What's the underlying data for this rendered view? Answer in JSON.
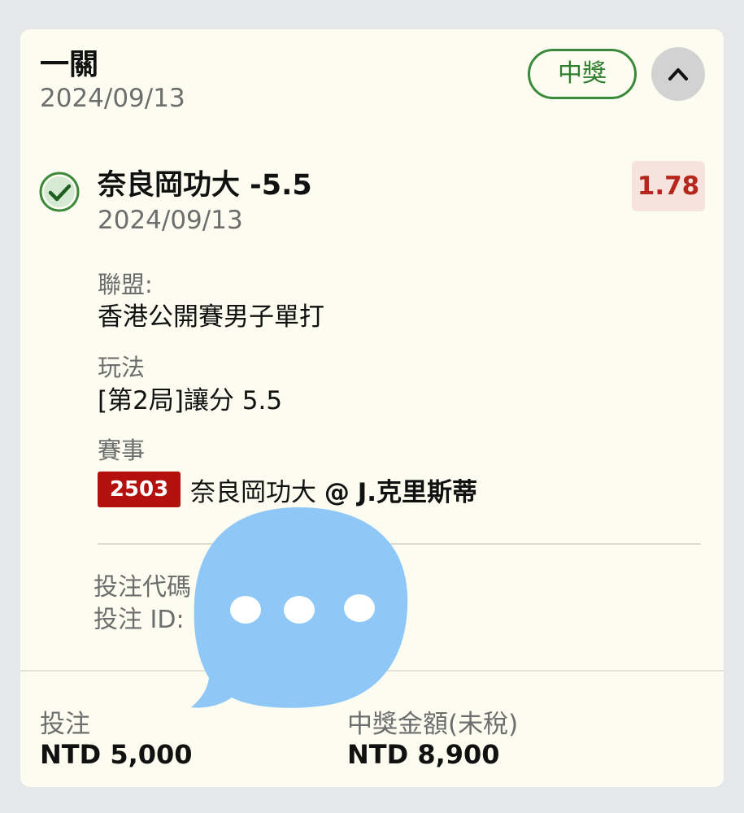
{
  "bet": {
    "type": "一關",
    "date": "2024/09/13",
    "status": "中獎"
  },
  "selection": {
    "name": "奈良岡功大 -5.5",
    "date": "2024/09/13",
    "odds": "1.78",
    "league_label": "聯盟:",
    "league_value": "香港公開賽男子單打",
    "market_label": "玩法",
    "market_value": "[第2局]讓分 5.5",
    "event_label": "賽事",
    "event_id": "2503",
    "event_home": "奈良岡功大",
    "event_sep": "@",
    "event_away": "J.克里斯蒂"
  },
  "codes": {
    "bet_code_label": "投注代碼",
    "bet_id_label": "投注 ID:"
  },
  "summary": {
    "stake_label": "投注",
    "stake_value": "NTD 5,000",
    "payout_label": "中獎金額(未稅)",
    "payout_value": "NTD 8,900"
  },
  "icons": {
    "check": "check-circle-icon",
    "collapse": "chevron-up-icon",
    "overlay": "chat-bubble-icon"
  },
  "colors": {
    "win_green": "#3b8a3b",
    "odds_red": "#b7261d",
    "event_badge": "#b3100e",
    "overlay_blue": "#8fc8f7"
  }
}
